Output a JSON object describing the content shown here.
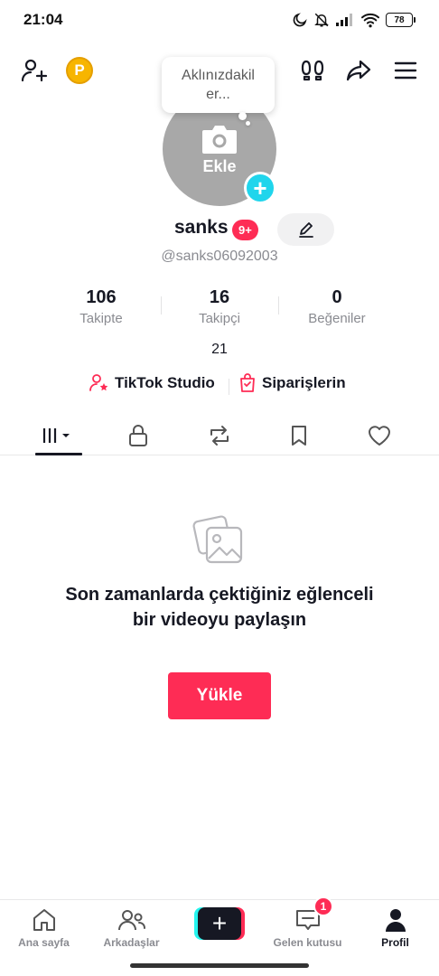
{
  "status_bar": {
    "time": "21:04",
    "battery": "78"
  },
  "avatar": {
    "add_label": "Ekle",
    "thought_bubble": "Aklınızdakil er..."
  },
  "profile": {
    "username": "sanks",
    "badge": "9+",
    "handle": "@sanks06092003",
    "bio": "21"
  },
  "stats": [
    {
      "value": "106",
      "label": "Takipte"
    },
    {
      "value": "16",
      "label": "Takipçi"
    },
    {
      "value": "0",
      "label": "Beğeniler"
    }
  ],
  "links": {
    "studio": "TikTok Studio",
    "orders": "Siparişlerin"
  },
  "tabs": [
    "videos-grid",
    "private",
    "reposts",
    "saved",
    "liked"
  ],
  "empty_state": {
    "message": "Son zamanlarda çektiğiniz eğlenceli bir videoyu paylaşın",
    "button": "Yükle"
  },
  "bottom_nav": {
    "home": "Ana sayfa",
    "friends": "Arkadaşlar",
    "inbox": "Gelen kutusu",
    "inbox_count": "1",
    "profile": "Profil"
  },
  "colors": {
    "accent": "#fe2c55",
    "cyan": "#25f4ee",
    "text": "#161823",
    "muted": "#8a8b91"
  }
}
